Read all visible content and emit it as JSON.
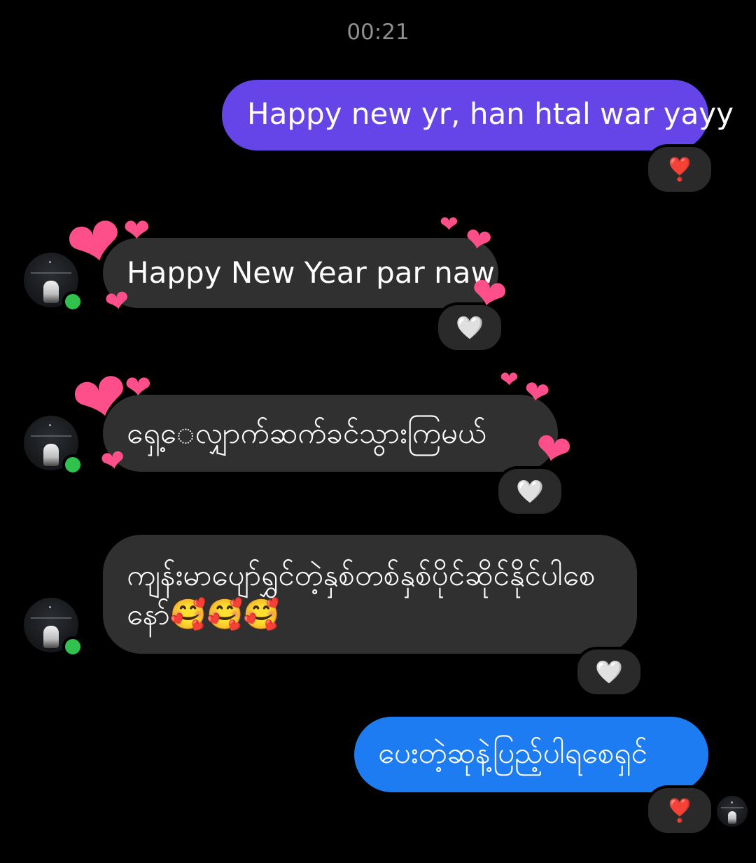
{
  "timestamp": "00:21",
  "messages": [
    {
      "id": "m1",
      "sender": "me",
      "text": "Happy new yr, han htal war yayy",
      "reaction": "❣️"
    },
    {
      "id": "m2",
      "sender": "them",
      "text": "Happy New Year par naw",
      "reaction": "🤍"
    },
    {
      "id": "m3",
      "sender": "them",
      "text": "ရှေ့ေလျှာက်ဆက်ခင်သွားကြမယ်",
      "reaction": "🤍"
    },
    {
      "id": "m4",
      "sender": "them",
      "text": "ကျန်းမာပျော်ရွှင်တဲ့နှစ်တစ်နှစ်ပိုင်ဆိုင်နိုင်ပါစေနော်🥰🥰🥰",
      "reaction": "🤍"
    },
    {
      "id": "m5",
      "sender": "me",
      "text": "ပေးတဲ့ဆုနဲ့ပြည့်ပါရစေရှင်",
      "reaction": "❣️"
    }
  ],
  "icons": {
    "heart_effect": "❤",
    "contact_avatar": "avatar-icon",
    "online_indicator": "online-dot-icon"
  },
  "colors": {
    "outgoing_purple": "#6544e8",
    "outgoing_blue": "#1e7cf2",
    "incoming": "#303030",
    "online": "#31c24d",
    "heart_effect": "#ff4f8b"
  }
}
